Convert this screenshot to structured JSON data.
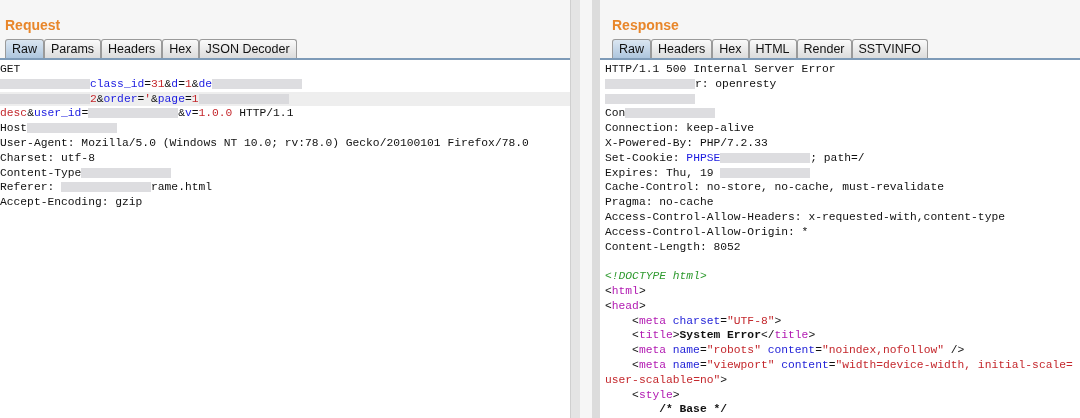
{
  "request": {
    "title": "Request",
    "tabs": [
      {
        "label": "Raw",
        "selected": true
      },
      {
        "label": "Params",
        "selected": false
      },
      {
        "label": "Headers",
        "selected": false
      },
      {
        "label": "Hex",
        "selected": false
      },
      {
        "label": "JSON Decoder",
        "selected": false
      }
    ],
    "lines": [
      {
        "selected": false,
        "segments": [
          {
            "kind": "plain",
            "text": "GET"
          }
        ]
      },
      {
        "selected": false,
        "segments": [
          {
            "kind": "redacted"
          },
          {
            "kind": "name",
            "text": "class_id"
          },
          {
            "kind": "plain",
            "text": "="
          },
          {
            "kind": "value",
            "text": "31"
          },
          {
            "kind": "plain",
            "text": "&"
          },
          {
            "kind": "name",
            "text": "d"
          },
          {
            "kind": "plain",
            "text": "="
          },
          {
            "kind": "value",
            "text": "1"
          },
          {
            "kind": "plain",
            "text": "&"
          },
          {
            "kind": "name",
            "text": "de"
          },
          {
            "kind": "redacted"
          }
        ]
      },
      {
        "selected": true,
        "segments": [
          {
            "kind": "redacted"
          },
          {
            "kind": "value",
            "text": "2"
          },
          {
            "kind": "plain",
            "text": "&"
          },
          {
            "kind": "name",
            "text": "order"
          },
          {
            "kind": "plain",
            "text": "="
          },
          {
            "kind": "value",
            "text": "'"
          },
          {
            "kind": "plain",
            "text": "&"
          },
          {
            "kind": "name",
            "text": "page"
          },
          {
            "kind": "plain",
            "text": "="
          },
          {
            "kind": "value",
            "text": "1"
          },
          {
            "kind": "redacted"
          }
        ]
      },
      {
        "selected": false,
        "segments": [
          {
            "kind": "value",
            "text": "desc"
          },
          {
            "kind": "plain",
            "text": "&"
          },
          {
            "kind": "name",
            "text": "user_id"
          },
          {
            "kind": "plain",
            "text": "="
          },
          {
            "kind": "redacted"
          },
          {
            "kind": "plain",
            "text": "&"
          },
          {
            "kind": "name",
            "text": "v"
          },
          {
            "kind": "plain",
            "text": "="
          },
          {
            "kind": "value",
            "text": "1.0.0"
          },
          {
            "kind": "plain",
            "text": " HTTP/1.1"
          }
        ]
      },
      {
        "selected": false,
        "segments": [
          {
            "kind": "plain",
            "text": "Host"
          },
          {
            "kind": "redacted"
          }
        ]
      },
      {
        "selected": false,
        "segments": [
          {
            "kind": "plain",
            "text": "User-Agent: Mozilla/5.0 (Windows NT 10.0; rv:78.0) Gecko/20100101 Firefox/78.0"
          }
        ]
      },
      {
        "selected": false,
        "segments": [
          {
            "kind": "plain",
            "text": "Charset: utf-8"
          }
        ]
      },
      {
        "selected": false,
        "segments": [
          {
            "kind": "plain",
            "text": "Content-Type"
          },
          {
            "kind": "redacted"
          }
        ]
      },
      {
        "selected": false,
        "segments": [
          {
            "kind": "plain",
            "text": "Referer: "
          },
          {
            "kind": "redacted"
          },
          {
            "kind": "plain",
            "text": "rame.html"
          }
        ]
      },
      {
        "selected": false,
        "segments": [
          {
            "kind": "plain",
            "text": "Accept-Encoding: gzip"
          }
        ]
      }
    ]
  },
  "response": {
    "title": "Response",
    "tabs": [
      {
        "label": "Raw",
        "selected": true
      },
      {
        "label": "Headers",
        "selected": false
      },
      {
        "label": "Hex",
        "selected": false
      },
      {
        "label": "HTML",
        "selected": false
      },
      {
        "label": "Render",
        "selected": false
      },
      {
        "label": "SSTVINFO",
        "selected": false
      }
    ],
    "lines": [
      {
        "selected": false,
        "segments": [
          {
            "kind": "plain",
            "text": "HTTP/1.1 500 Internal Server Error"
          }
        ]
      },
      {
        "selected": false,
        "segments": [
          {
            "kind": "redacted"
          },
          {
            "kind": "plain",
            "text": "r: openresty"
          }
        ]
      },
      {
        "selected": false,
        "segments": [
          {
            "kind": "redacted"
          }
        ]
      },
      {
        "selected": false,
        "segments": [
          {
            "kind": "plain",
            "text": "Con"
          },
          {
            "kind": "redacted"
          }
        ]
      },
      {
        "selected": false,
        "segments": [
          {
            "kind": "plain",
            "text": "Connection: keep-alive"
          }
        ]
      },
      {
        "selected": false,
        "segments": [
          {
            "kind": "plain",
            "text": "X-Powered-By: PHP/7.2.33"
          }
        ]
      },
      {
        "selected": false,
        "segments": [
          {
            "kind": "plain",
            "text": "Set-Cookie: "
          },
          {
            "kind": "name",
            "text": "PHPSE"
          },
          {
            "kind": "redacted"
          },
          {
            "kind": "plain",
            "text": "; path=/"
          }
        ]
      },
      {
        "selected": false,
        "segments": [
          {
            "kind": "plain",
            "text": "Expires: Thu, 19 "
          },
          {
            "kind": "redacted"
          }
        ]
      },
      {
        "selected": false,
        "segments": [
          {
            "kind": "plain",
            "text": "Cache-Control: no-store, no-cache, must-revalidate"
          }
        ]
      },
      {
        "selected": false,
        "segments": [
          {
            "kind": "plain",
            "text": "Pragma: no-cache"
          }
        ]
      },
      {
        "selected": false,
        "segments": [
          {
            "kind": "plain",
            "text": "Access-Control-Allow-Headers: x-requested-with,content-type"
          }
        ]
      },
      {
        "selected": false,
        "segments": [
          {
            "kind": "plain",
            "text": "Access-Control-Allow-Origin: *"
          }
        ]
      },
      {
        "selected": false,
        "segments": [
          {
            "kind": "plain",
            "text": "Content-Length: 8052"
          }
        ]
      },
      {
        "selected": false
      },
      {
        "selected": false,
        "segments": [
          {
            "kind": "comment",
            "text": "<!DOCTYPE html>"
          }
        ]
      },
      {
        "selected": false,
        "segments": [
          {
            "kind": "plain",
            "text": "<"
          },
          {
            "kind": "tag",
            "text": "html"
          },
          {
            "kind": "plain",
            "text": ">"
          }
        ]
      },
      {
        "selected": false,
        "segments": [
          {
            "kind": "plain",
            "text": "<"
          },
          {
            "kind": "tag",
            "text": "head"
          },
          {
            "kind": "plain",
            "text": ">"
          }
        ]
      },
      {
        "selected": false,
        "segments": [
          {
            "kind": "indent"
          },
          {
            "kind": "plain",
            "text": "<"
          },
          {
            "kind": "tag",
            "text": "meta"
          },
          {
            "kind": "space"
          },
          {
            "kind": "attr",
            "text": "charset"
          },
          {
            "kind": "plain",
            "text": "="
          },
          {
            "kind": "value",
            "text": "\"UTF-8\""
          },
          {
            "kind": "plain",
            "text": ">"
          }
        ]
      },
      {
        "selected": false,
        "segments": [
          {
            "kind": "indent"
          },
          {
            "kind": "plain",
            "text": "<"
          },
          {
            "kind": "tag",
            "text": "title"
          },
          {
            "kind": "plain",
            "text": ">"
          },
          {
            "kind": "bold",
            "text": "System Error"
          },
          {
            "kind": "plain",
            "text": "</"
          },
          {
            "kind": "tag",
            "text": "title"
          },
          {
            "kind": "plain",
            "text": ">"
          }
        ]
      },
      {
        "selected": false,
        "segments": [
          {
            "kind": "indent"
          },
          {
            "kind": "plain",
            "text": "<"
          },
          {
            "kind": "tag",
            "text": "meta"
          },
          {
            "kind": "space"
          },
          {
            "kind": "attr",
            "text": "name"
          },
          {
            "kind": "plain",
            "text": "="
          },
          {
            "kind": "value",
            "text": "\"robots\""
          },
          {
            "kind": "space"
          },
          {
            "kind": "attr",
            "text": "content"
          },
          {
            "kind": "plain",
            "text": "="
          },
          {
            "kind": "value",
            "text": "\"noindex,nofollow\""
          },
          {
            "kind": "plain",
            "text": " />"
          }
        ]
      },
      {
        "selected": false,
        "segments": [
          {
            "kind": "indent"
          },
          {
            "kind": "plain",
            "text": "<"
          },
          {
            "kind": "tag",
            "text": "meta"
          },
          {
            "kind": "space"
          },
          {
            "kind": "attr",
            "text": "name"
          },
          {
            "kind": "plain",
            "text": "="
          },
          {
            "kind": "value",
            "text": "\"viewport\""
          },
          {
            "kind": "space"
          },
          {
            "kind": "attr",
            "text": "content"
          },
          {
            "kind": "plain",
            "text": "="
          },
          {
            "kind": "value",
            "text": "\"width=device-width, initial-scale="
          }
        ]
      },
      {
        "selected": false,
        "segments": [
          {
            "kind": "value",
            "text": "user-scalable=no\""
          },
          {
            "kind": "plain",
            "text": ">"
          }
        ]
      },
      {
        "selected": false,
        "segments": [
          {
            "kind": "indent"
          },
          {
            "kind": "plain",
            "text": "<"
          },
          {
            "kind": "tag",
            "text": "style"
          },
          {
            "kind": "plain",
            "text": ">"
          }
        ]
      },
      {
        "selected": false,
        "segments": [
          {
            "kind": "indent"
          },
          {
            "kind": "indent"
          },
          {
            "kind": "bold",
            "text": "/* Base */"
          }
        ]
      }
    ]
  }
}
